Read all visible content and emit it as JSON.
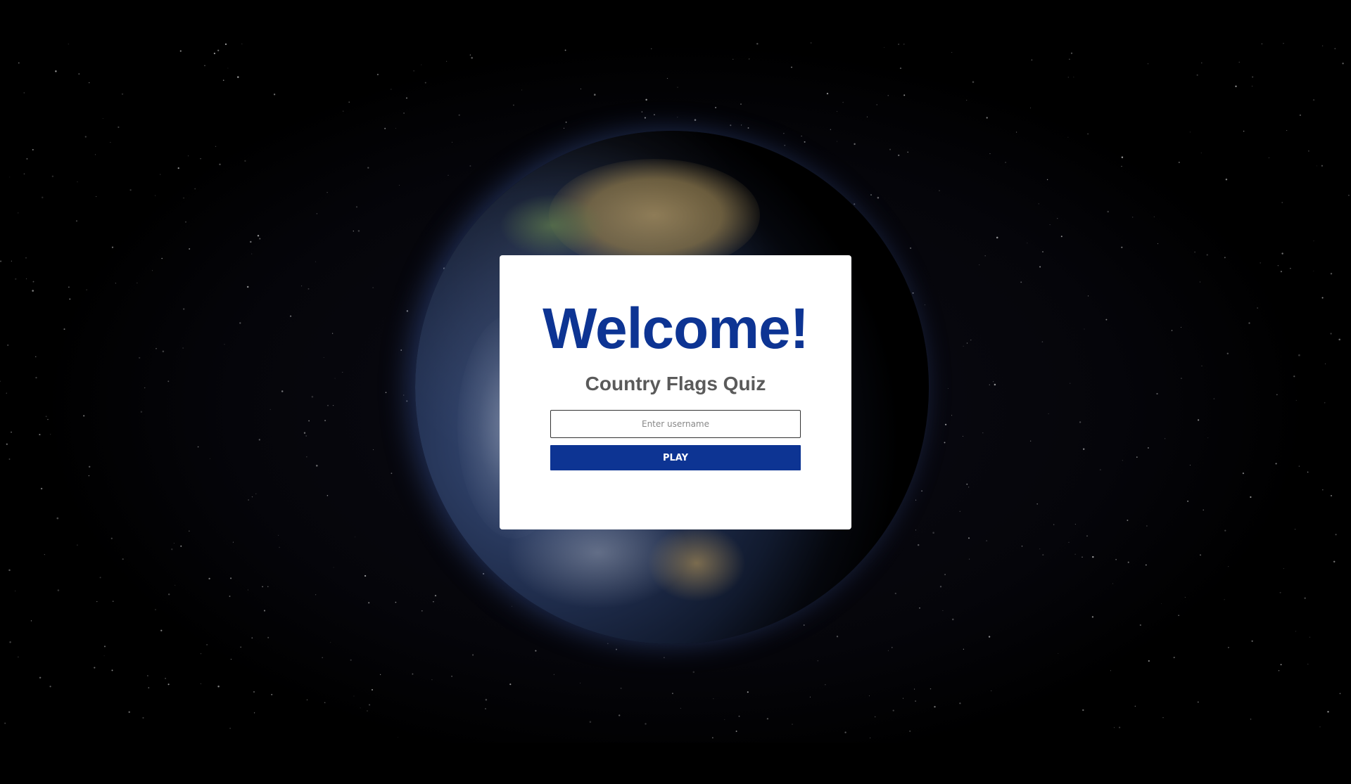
{
  "modal": {
    "title": "Welcome!",
    "subtitle": "Country Flags Quiz",
    "username_input": {
      "value": "",
      "placeholder": "Enter username"
    },
    "play_button_label": "PLAY"
  },
  "colors": {
    "brand_blue": "#0d3493",
    "subtitle_gray": "#5a5a5a",
    "background": "#000000",
    "modal_background": "#ffffff"
  },
  "background_image": "earth-from-space"
}
